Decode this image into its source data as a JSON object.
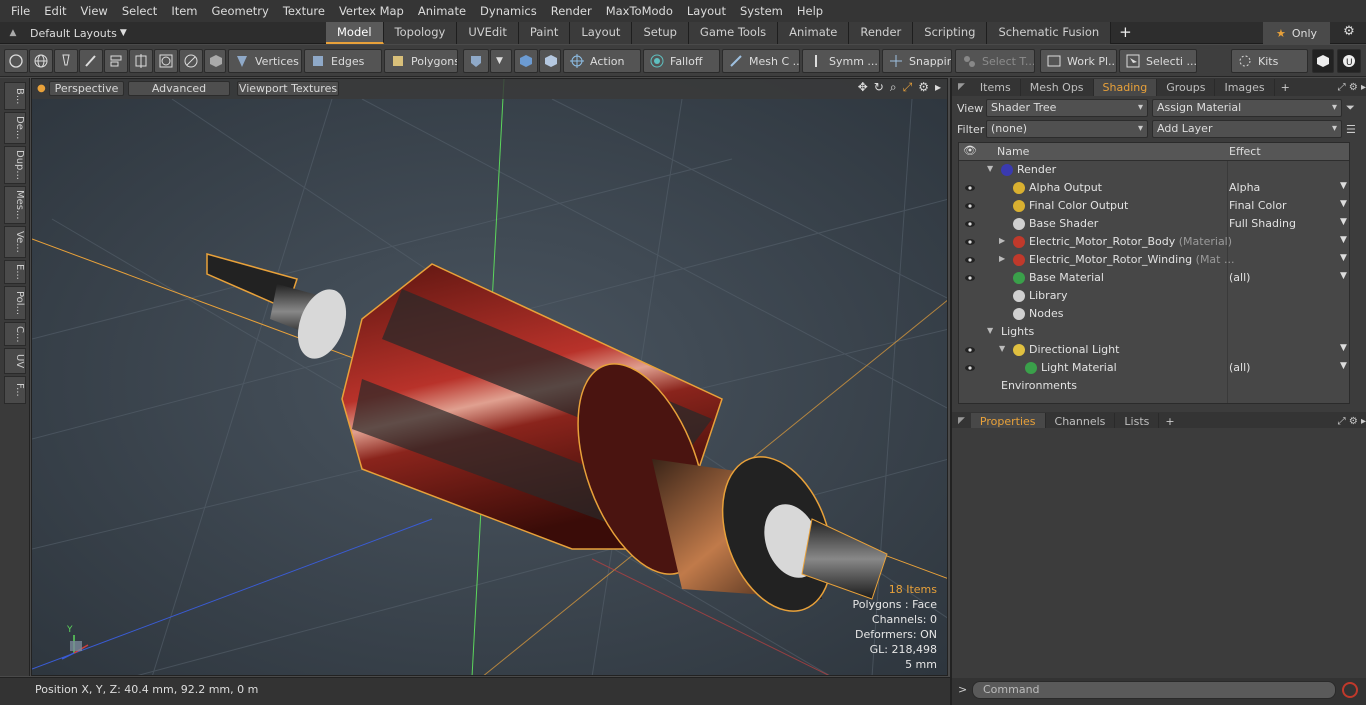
{
  "menu": [
    "File",
    "Edit",
    "View",
    "Select",
    "Item",
    "Geometry",
    "Texture",
    "Vertex Map",
    "Animate",
    "Dynamics",
    "Render",
    "MaxToModo",
    "Layout",
    "System",
    "Help"
  ],
  "layouts": {
    "label": "Default Layouts"
  },
  "tabs": [
    "Model",
    "Topology",
    "UVEdit",
    "Paint",
    "Layout",
    "Setup",
    "Game Tools",
    "Animate",
    "Render",
    "Scripting",
    "Schematic Fusion"
  ],
  "active_tab": "Model",
  "only_label": "Only",
  "toolbar": {
    "vertices": "Vertices",
    "edges": "Edges",
    "polygons": "Polygons",
    "action": "Action",
    "falloff": "Falloff",
    "mesh": "Mesh C ...",
    "symm": "Symm ...",
    "snapping": "Snapping",
    "select_t": "Select T...",
    "work_pl": "Work Pl...",
    "selecti": "Selecti ...",
    "kits": "Kits"
  },
  "left_tabs": [
    "B...",
    "De...",
    "Dup...",
    "Mes...",
    "Ve...",
    "E...",
    "Pol...",
    "C...",
    "UV",
    "F..."
  ],
  "viewport": {
    "perspective": "Perspective",
    "advanced": "Advanced",
    "textures": "Viewport Textures",
    "stats": {
      "items": "18 Items",
      "polygons": "Polygons : Face",
      "channels": "Channels: 0",
      "deformers": "Deformers: ON",
      "gl": "GL: 218,498",
      "scale": "5 mm"
    },
    "axis_y": "Y"
  },
  "status": {
    "position": "Position X, Y, Z:   40.4 mm, 92.2 mm, 0 m"
  },
  "panel_tabs": [
    "Items",
    "Mesh Ops",
    "Shading",
    "Groups",
    "Images"
  ],
  "panel_active": "Shading",
  "view_row": {
    "label": "View",
    "value": "Shader Tree",
    "assign": "Assign Material"
  },
  "filter_row": {
    "label": "Filter",
    "value": "(none)",
    "add": "Add Layer"
  },
  "tree": {
    "col_name": "Name",
    "col_effect": "Effect",
    "rows": [
      {
        "name": "Render",
        "sub": "",
        "effect": "",
        "eye": false,
        "icon": "#3a3ab0"
      },
      {
        "name": "Alpha Output",
        "sub": "",
        "effect": "Alpha",
        "eye": true,
        "icon": "#d9b030"
      },
      {
        "name": "Final Color Output",
        "sub": "",
        "effect": "Final Color",
        "eye": true,
        "icon": "#d9b030"
      },
      {
        "name": "Base Shader",
        "sub": "",
        "effect": "Full Shading",
        "eye": true,
        "icon": "#cfcfcf"
      },
      {
        "name": "Electric_Motor_Rotor_Body",
        "sub": " (Material)",
        "effect": "",
        "eye": true,
        "icon": "#c0392b"
      },
      {
        "name": "Electric_Motor_Rotor_Winding",
        "sub": " (Mat ...",
        "effect": "",
        "eye": true,
        "icon": "#c0392b"
      },
      {
        "name": "Base Material",
        "sub": "",
        "effect": "(all)",
        "eye": true,
        "icon": "#3aa04a"
      },
      {
        "name": "Library",
        "sub": "",
        "effect": "",
        "eye": false,
        "icon": "#d0d0d0"
      },
      {
        "name": "Nodes",
        "sub": "",
        "effect": "",
        "eye": false,
        "icon": "#d0d0d0"
      },
      {
        "name": "Lights",
        "sub": "",
        "effect": "",
        "eye": false,
        "icon": ""
      },
      {
        "name": "Directional Light",
        "sub": "",
        "effect": "",
        "eye": true,
        "icon": "#e0c040"
      },
      {
        "name": "Light Material",
        "sub": "",
        "effect": "(all)",
        "eye": true,
        "icon": "#3aa04a"
      },
      {
        "name": "Environments",
        "sub": "",
        "effect": "",
        "eye": false,
        "icon": ""
      }
    ]
  },
  "props_tabs": [
    "Properties",
    "Channels",
    "Lists"
  ],
  "props_active": "Properties",
  "command": {
    "placeholder": "Command"
  }
}
